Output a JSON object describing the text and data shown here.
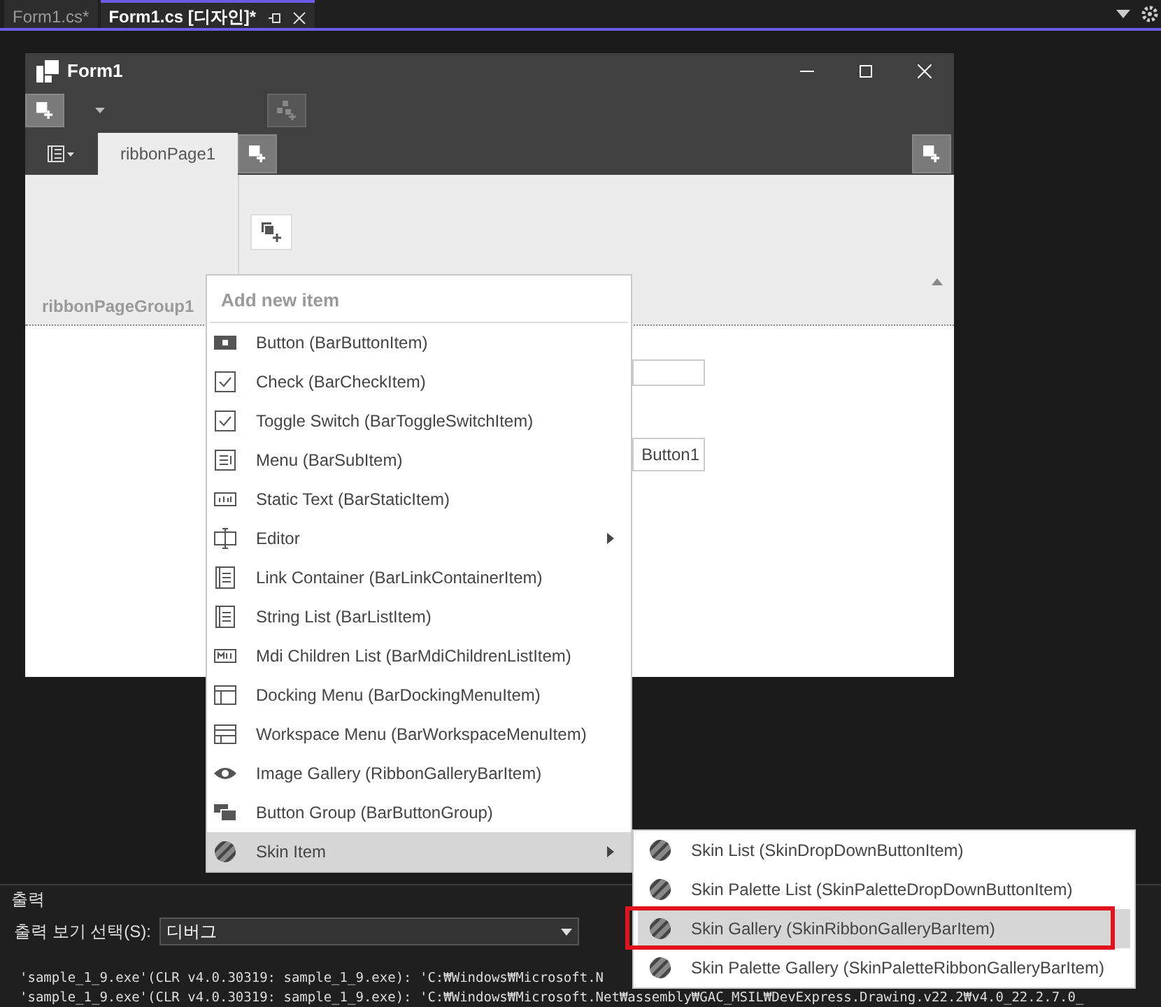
{
  "document_tabs": [
    {
      "label": "Form1.cs*",
      "selected": false
    },
    {
      "label": "Form1.cs [디자인]*",
      "selected": true
    }
  ],
  "form": {
    "title": "Form1",
    "ribbon": {
      "pages": [
        {
          "label": "ribbonPage1",
          "selected": true
        }
      ],
      "groups": [
        {
          "label": "ribbonPageGroup1"
        }
      ]
    },
    "controls": [
      {
        "kind": "textbox"
      },
      {
        "kind": "button",
        "label": "Button1"
      }
    ]
  },
  "context_menu": {
    "header": "Add new item",
    "items": [
      {
        "label": "Button (BarButtonItem)",
        "kind": "button",
        "submenu": false,
        "selected": false
      },
      {
        "label": "Check (BarCheckItem)",
        "kind": "check",
        "submenu": false,
        "selected": false
      },
      {
        "label": "Toggle Switch (BarToggleSwitchItem)",
        "kind": "check",
        "submenu": false,
        "selected": false
      },
      {
        "label": "Menu (BarSubItem)",
        "kind": "menu",
        "submenu": false,
        "selected": false
      },
      {
        "label": "Static Text (BarStaticItem)",
        "kind": "static",
        "submenu": false,
        "selected": false
      },
      {
        "label": "Editor",
        "kind": "editor",
        "submenu": true,
        "selected": false
      },
      {
        "label": "Link Container (BarLinkContainerItem)",
        "kind": "list",
        "submenu": false,
        "selected": false
      },
      {
        "label": "String List (BarListItem)",
        "kind": "list",
        "submenu": false,
        "selected": false
      },
      {
        "label": "Mdi Children List (BarMdiChildrenListItem)",
        "kind": "mdi",
        "submenu": false,
        "selected": false
      },
      {
        "label": "Docking Menu (BarDockingMenuItem)",
        "kind": "docking",
        "submenu": false,
        "selected": false
      },
      {
        "label": "Workspace Menu (BarWorkspaceMenuItem)",
        "kind": "workspace",
        "submenu": false,
        "selected": false
      },
      {
        "label": "Image Gallery (RibbonGalleryBarItem)",
        "kind": "eye",
        "submenu": false,
        "selected": false
      },
      {
        "label": "Button Group (BarButtonGroup)",
        "kind": "group",
        "submenu": false,
        "selected": false
      },
      {
        "label": "Skin Item",
        "kind": "skin",
        "submenu": true,
        "selected": true
      }
    ]
  },
  "submenu": {
    "items": [
      {
        "label": "Skin List (SkinDropDownButtonItem)",
        "selected": false,
        "outlined": false
      },
      {
        "label": "Skin Palette List (SkinPaletteDropDownButtonItem)",
        "selected": false,
        "outlined": false
      },
      {
        "label": "Skin Gallery (SkinRibbonGalleryBarItem)",
        "selected": true,
        "outlined": true
      },
      {
        "label": "Skin Palette Gallery (SkinPaletteRibbonGalleryBarItem)",
        "selected": false,
        "outlined": false
      }
    ]
  },
  "output": {
    "title": "출력",
    "source_label": "출력 보기 선택(S):",
    "source": "디버그",
    "lines": [
      "'sample_1_9.exe'(CLR v4.0.30319: sample_1_9.exe): 'C:₩Windows₩Microsoft.N",
      "'sample_1_9.exe'(CLR v4.0.30319: sample_1_9.exe): 'C:₩Windows₩Microsoft.Net₩assembly₩GAC_MSIL₩DevExpress.Drawing.v22.2₩v4.0_22.2.7.0_"
    ]
  }
}
